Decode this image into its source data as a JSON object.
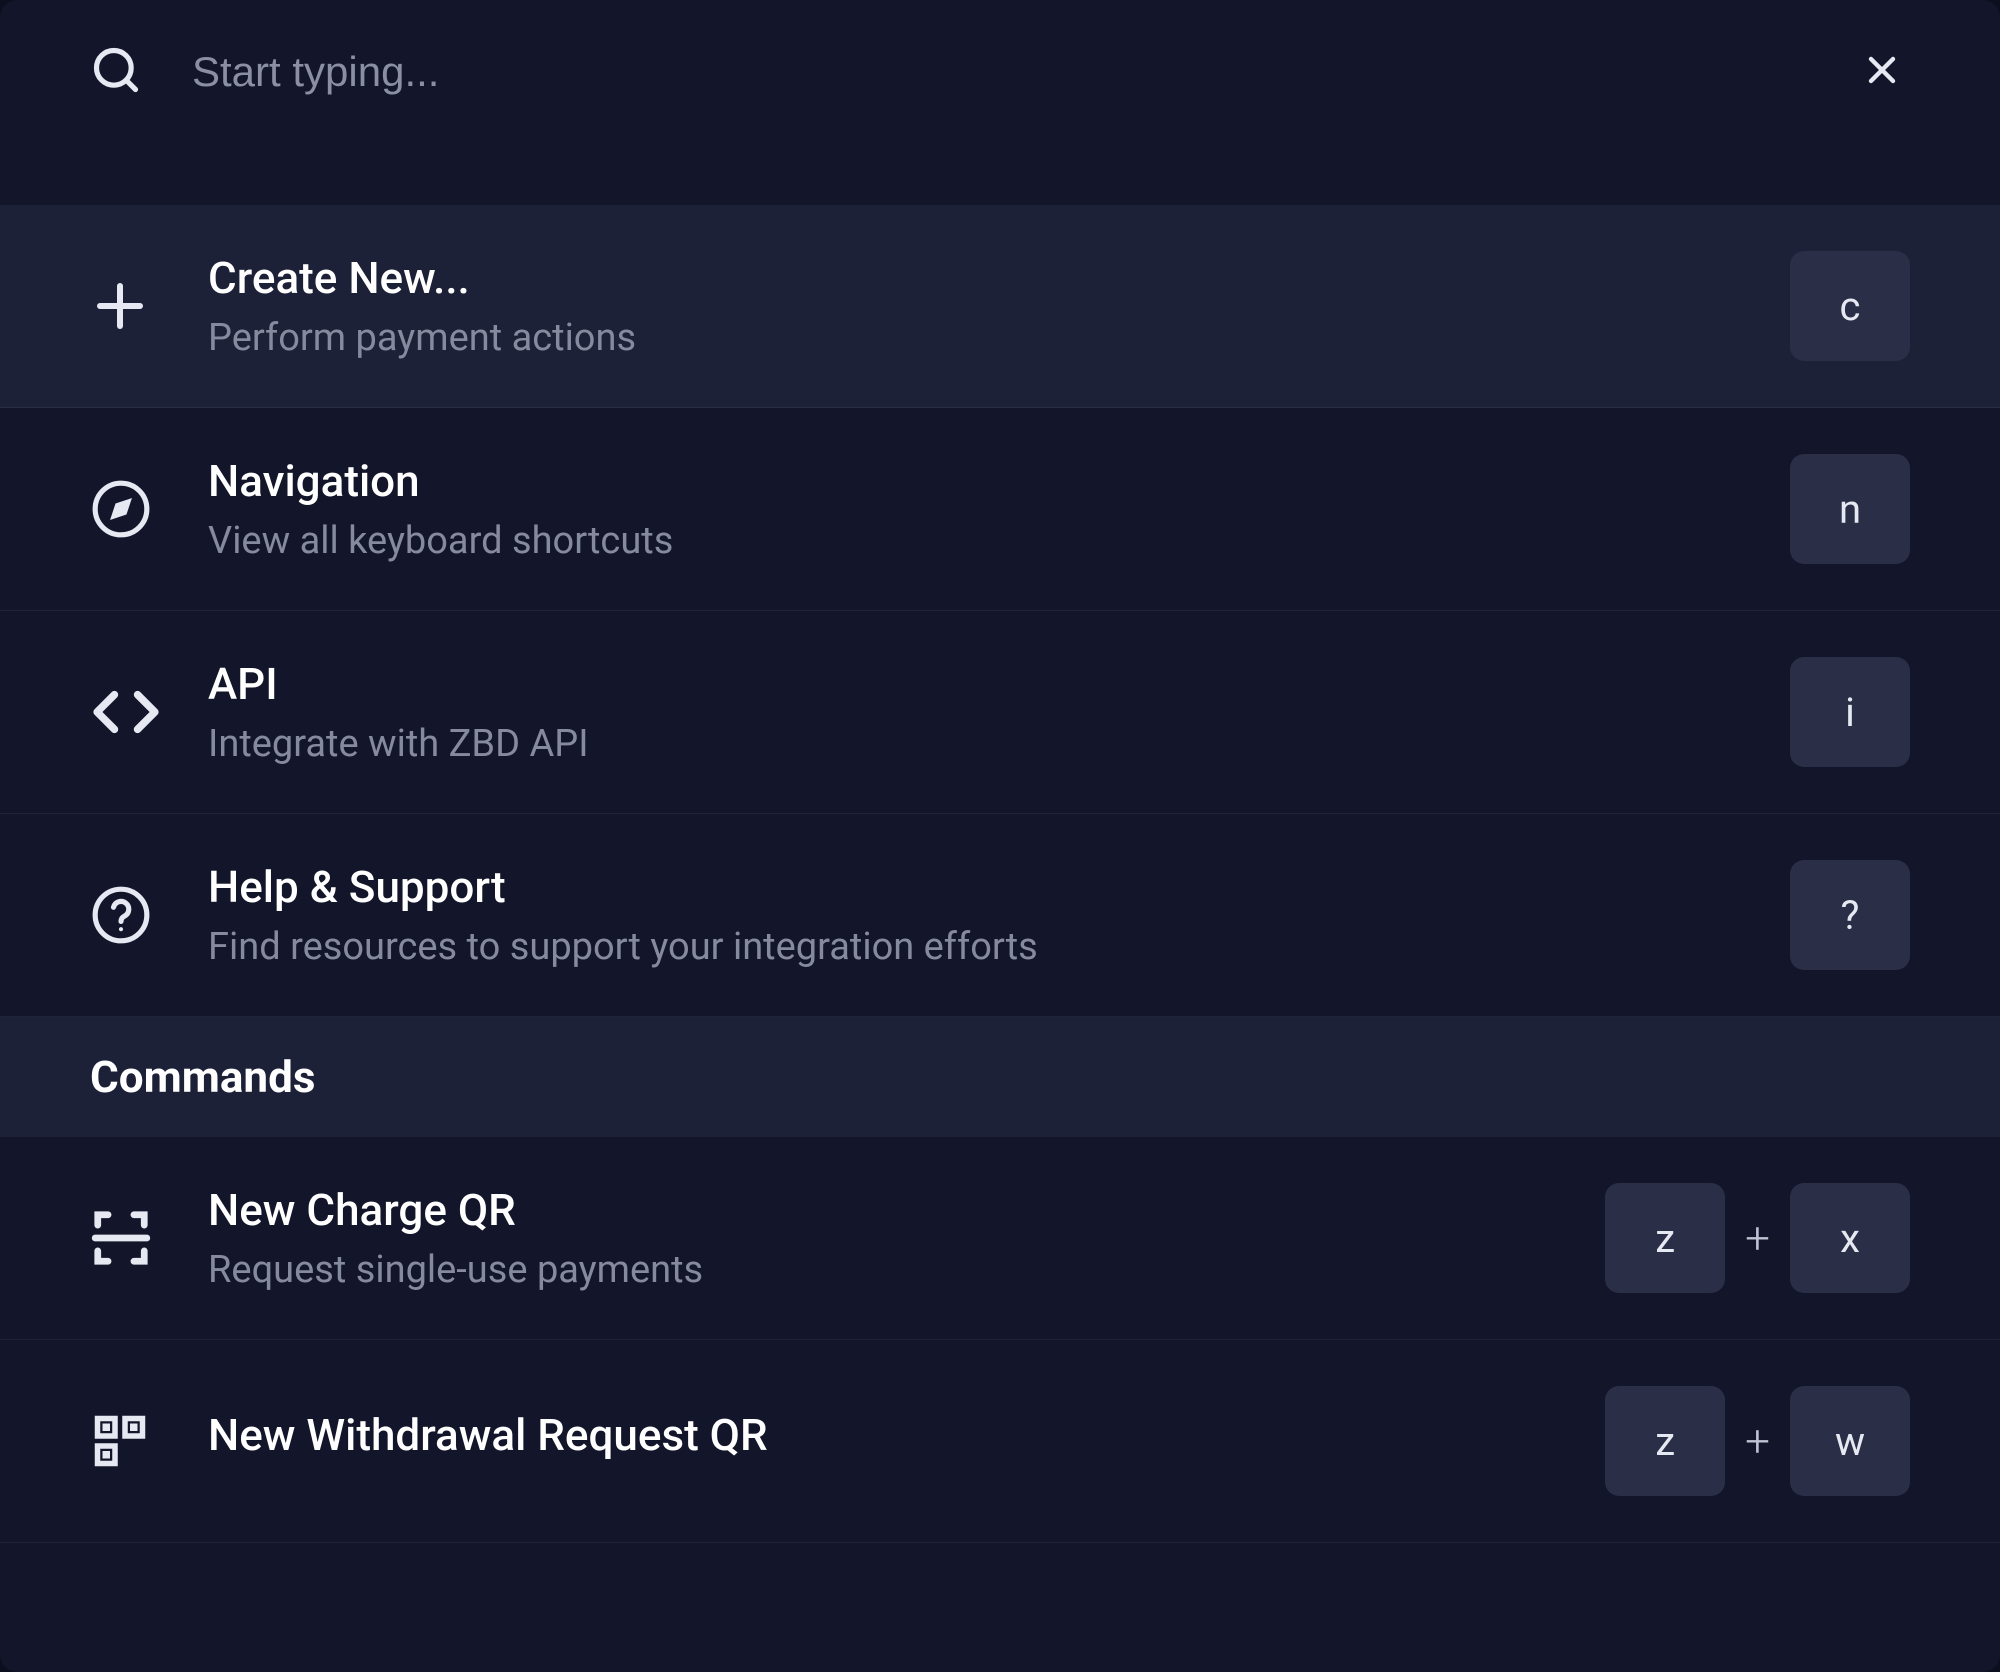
{
  "search": {
    "placeholder": "Start typing..."
  },
  "items": [
    {
      "title": "Create New...",
      "desc": "Perform payment actions",
      "keys": [
        "c"
      ]
    },
    {
      "title": "Navigation",
      "desc": "View all keyboard shortcuts",
      "keys": [
        "n"
      ]
    },
    {
      "title": "API",
      "desc": "Integrate with ZBD API",
      "keys": [
        "i"
      ]
    },
    {
      "title": "Help & Support",
      "desc": "Find resources to support your integration efforts",
      "keys": [
        "?"
      ]
    }
  ],
  "section_label": "Commands",
  "commands": [
    {
      "title": "New Charge QR",
      "desc": "Request single-use payments",
      "keys": [
        "z",
        "x"
      ]
    },
    {
      "title": "New Withdrawal Request QR",
      "desc": "",
      "keys": [
        "z",
        "w"
      ]
    }
  ],
  "key_join": "+"
}
